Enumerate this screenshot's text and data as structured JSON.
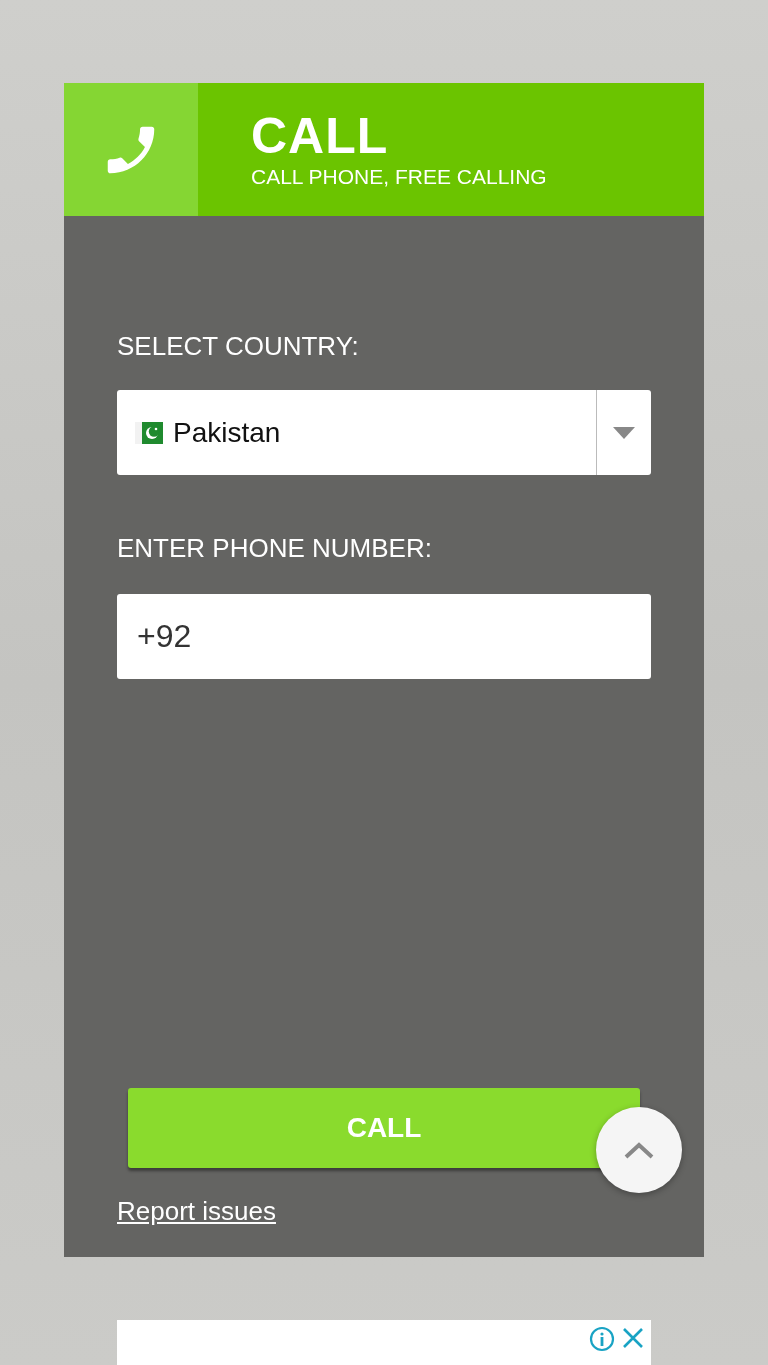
{
  "header": {
    "title": "CALL",
    "subtitle": "CALL PHONE, FREE CALLING"
  },
  "country": {
    "label": "SELECT COUNTRY:",
    "value": "Pakistan"
  },
  "phone": {
    "label": "ENTER PHONE NUMBER:",
    "value": "+92"
  },
  "call_button": "CALL",
  "report_link": "Report issues"
}
